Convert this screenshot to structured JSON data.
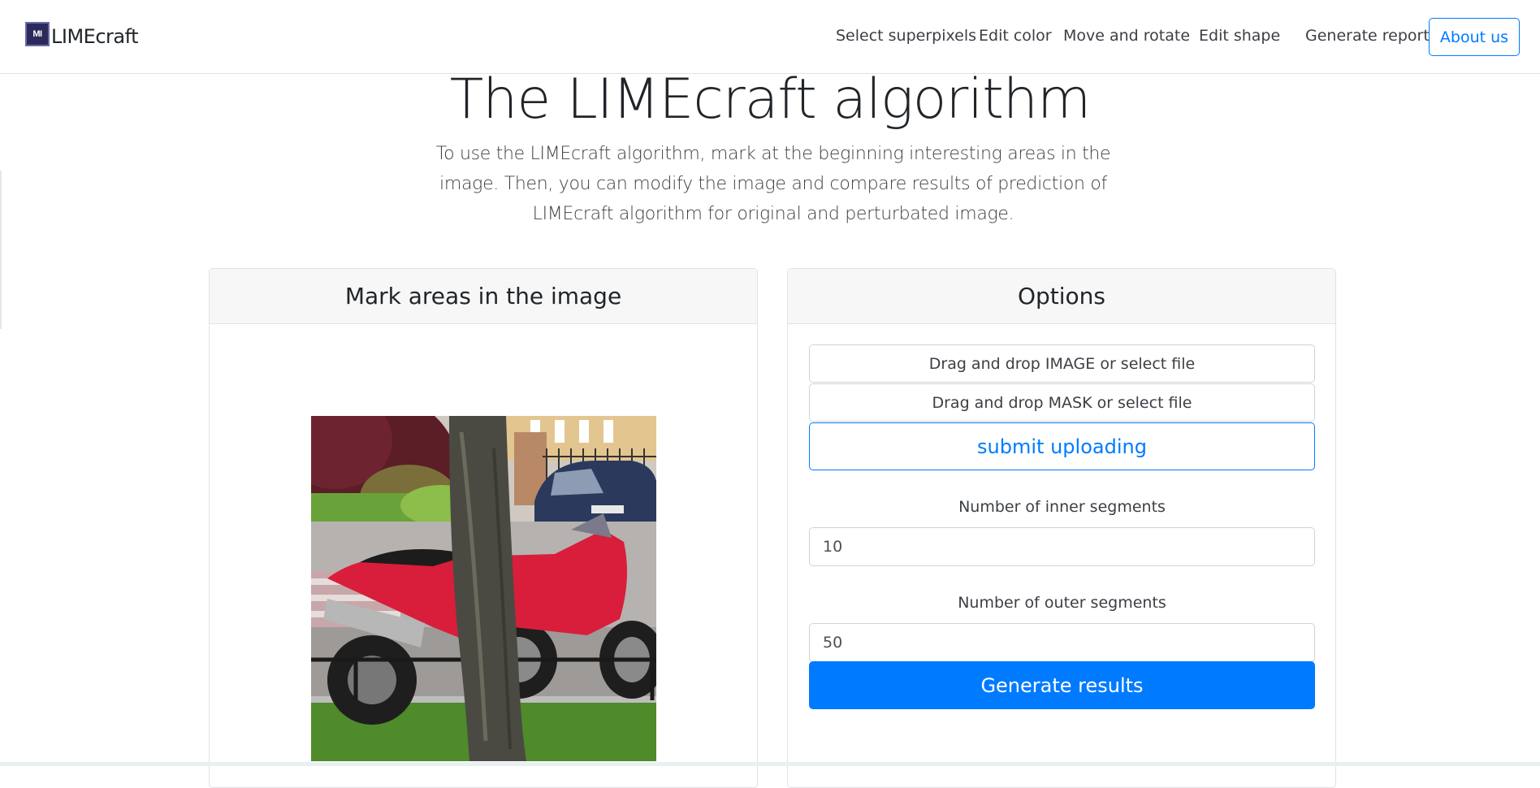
{
  "navbar": {
    "logo_text": "MI",
    "brand": "LIMEcraft",
    "links": [
      "Select superpixels",
      "Edit color",
      "Move and rotate",
      "Edit shape",
      "Generate report"
    ],
    "about": "About us"
  },
  "hero": {
    "title": "The LIMEcraft algorithm",
    "description": "To use the LIMEcraft algorithm, mark at the beginning interesting areas in the image. Then, you can modify the image and compare results of prediction of LIMEcraft algorithm for original and perturbated image."
  },
  "left_card": {
    "header": "Mark areas in the image"
  },
  "options": {
    "header": "Options",
    "upload_image": "Drag and drop IMAGE or select file",
    "upload_mask": "Drag and drop MASK or select file",
    "submit": "submit uploading",
    "inner_label": "Number of inner segments",
    "inner_value": "10",
    "outer_label": "Number of outer segments",
    "outer_value": "50",
    "generate": "Generate results"
  },
  "colors": {
    "primary": "#007bff",
    "card_header_bg": "#f7f7f7",
    "border": "#dfe2e6"
  }
}
